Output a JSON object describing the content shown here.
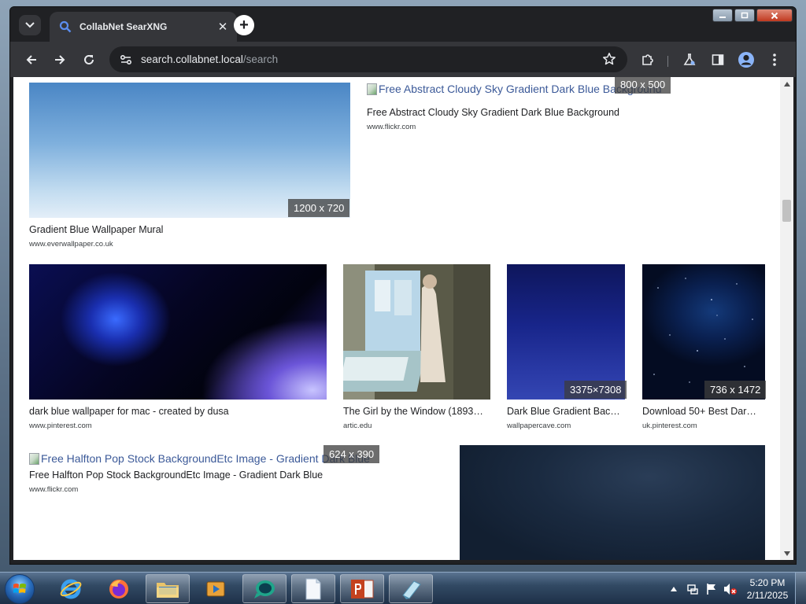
{
  "tab": {
    "title": "CollabNet SearXNG",
    "close_glyph": "✕",
    "new_tab_glyph": "+"
  },
  "toolbar": {
    "url_host": "search.collabnet.local",
    "url_path": "/search"
  },
  "results": [
    {
      "title": "Gradient Blue Wallpaper Mural",
      "source": "www.everwallpaper.co.uk",
      "dims": "1200 x 720",
      "icon": "gradient-sky-thumbnail"
    },
    {
      "link_text": "Free Abstract Cloudy Sky Gradient Dark Blue Background",
      "title": "Free Abstract Cloudy Sky Gradient Dark Blue Background",
      "source": "www.flickr.com",
      "dims": "800 x 500"
    },
    {
      "title": "dark blue wallpaper for mac - created by dusa",
      "source": "www.pinterest.com",
      "icon": "dark-blue-glow-thumbnail"
    },
    {
      "title": "The Girl by the Window (1893…",
      "source": "artic.edu",
      "icon": "painting-thumbnail"
    },
    {
      "title": "Dark Blue Gradient Bac…",
      "source": "wallpapercave.com",
      "dims": "3375×7308",
      "icon": "navy-gradient-thumbnail"
    },
    {
      "title": "Download 50+ Best Dar…",
      "source": "uk.pinterest.com",
      "dims": "736 x 1472",
      "icon": "starfield-thumbnail"
    },
    {
      "link_text": "Free Halfton Pop Stock BackgroundEtc Image - Gradient Dark Blue",
      "title": "Free Halfton Pop Stock BackgroundEtc Image - Gradient Dark Blue",
      "source": "www.flickr.com",
      "dims": "624 x 390"
    },
    {
      "icon": "dark-slate-thumbnail"
    }
  ],
  "taskbar": {
    "time": "5:20 PM",
    "date": "2/11/2025"
  }
}
